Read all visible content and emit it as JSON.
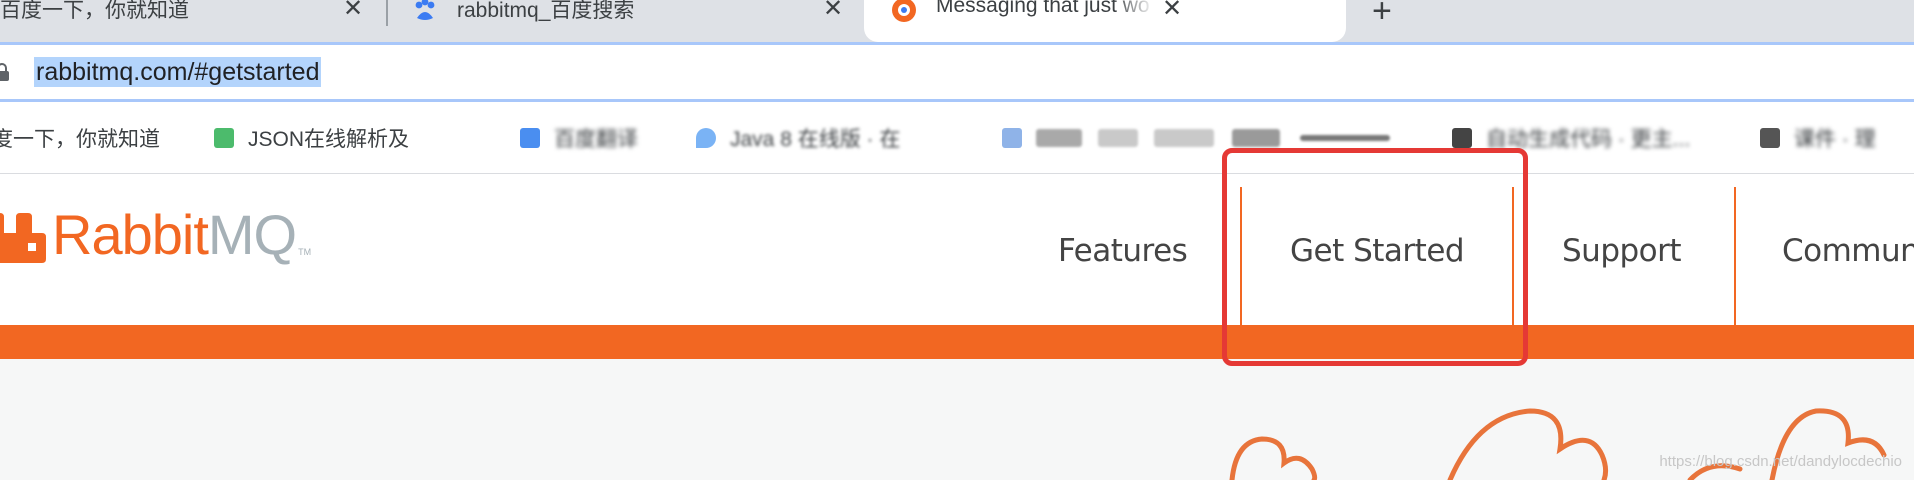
{
  "browser": {
    "tabs": [
      {
        "title": "百度一下，你就知道",
        "close": "✕",
        "active": false
      },
      {
        "title": "rabbitmq_百度搜索",
        "close": "✕",
        "active": false,
        "favicon": "baidu-paw-icon"
      },
      {
        "title": "Messaging that just works — R",
        "close": "✕",
        "active": true,
        "favicon": "rabbitmq-icon"
      }
    ],
    "new_tab": "+",
    "address_bar": {
      "url": "rabbitmq.com/#getstarted",
      "icon": "lock-icon"
    },
    "bookmarks": [
      {
        "label": "度一下，你就知道"
      },
      {
        "label": "JSON在线解析及"
      },
      {
        "label": "百度翻译"
      },
      {
        "label": "Java 8 在线版 · 在"
      },
      {
        "label": "自动生成代码 · 更主..."
      },
      {
        "label": "课件 · 理"
      }
    ]
  },
  "site": {
    "logo": {
      "rabbit": "Rabbit",
      "mq": "MQ",
      "tm": "TM",
      "brand_color": "#f26722",
      "secondary_color": "#a6b1b7"
    },
    "nav": [
      {
        "label": "Features"
      },
      {
        "label": "Get Started"
      },
      {
        "label": "Support"
      },
      {
        "label": "Commun"
      }
    ],
    "accent_color": "#f26722",
    "annotation_color": "#e53935",
    "watermark": "https://blog.csdn.net/dandylocdechio"
  }
}
